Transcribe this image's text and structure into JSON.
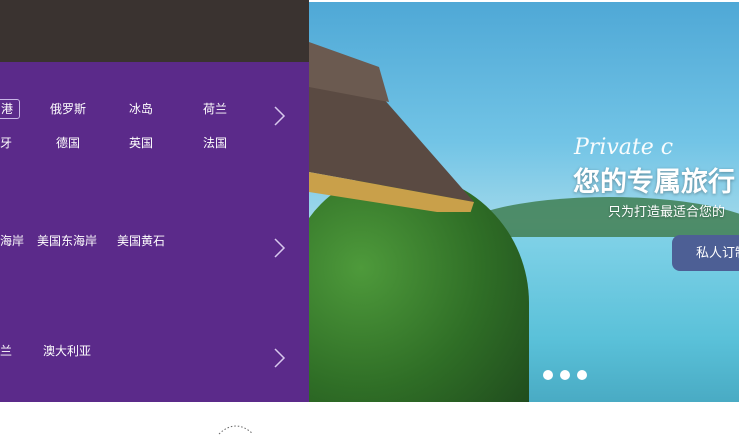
{
  "menu": {
    "rows": [
      {
        "items": [
          {
            "label": "港"
          },
          {
            "label": "俄罗斯"
          },
          {
            "label": "冰岛"
          },
          {
            "label": "荷兰"
          }
        ]
      },
      {
        "items": [
          {
            "label": "牙"
          },
          {
            "label": "德国"
          },
          {
            "label": "英国"
          },
          {
            "label": "法国"
          }
        ]
      },
      {
        "items": [
          {
            "label": "海岸"
          },
          {
            "label": "美国东海岸"
          },
          {
            "label": "美国黄石"
          }
        ]
      },
      {
        "items": [
          {
            "label": "兰"
          },
          {
            "label": "澳大利亚"
          }
        ]
      }
    ]
  },
  "hero": {
    "slogan": "Private c",
    "title": "您的专属旅行",
    "subtitle": "只为打造最适合您的",
    "cta_label": "私人订制",
    "slide_count": 3
  },
  "colors": {
    "topbar": "#3a3330",
    "menu_bg": "#5b2a8a",
    "cta_bg": "#4d5f95"
  },
  "icons": {
    "chevron": "chevron-right-icon",
    "bottom": "decorative-dotted-arc-icon"
  }
}
